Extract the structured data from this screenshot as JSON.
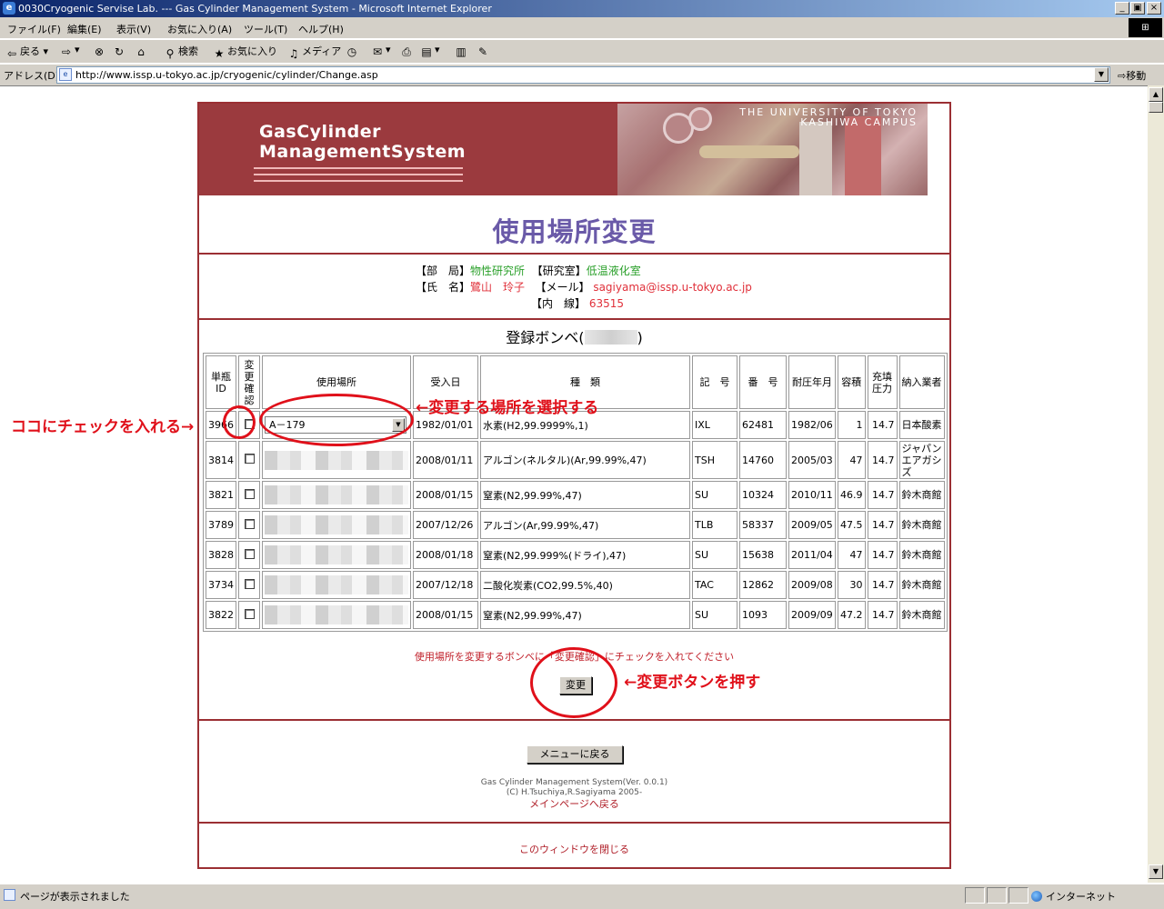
{
  "window": {
    "title": "0030Cryogenic Servise Lab. --- Gas Cylinder Management System - Microsoft Internet Explorer",
    "min": "_",
    "max": "▣",
    "close": "×"
  },
  "menu": [
    "ファイル(F)",
    "編集(E)",
    "表示(V)",
    "お気に入り(A)",
    "ツール(T)",
    "ヘルプ(H)"
  ],
  "toolbar": {
    "back": "戻る",
    "search": "検索",
    "favorites": "お気に入り",
    "media": "メディア"
  },
  "address": {
    "label": "アドレス(D)",
    "url": "http://www.issp.u-tokyo.ac.jp/cryogenic/cylinder/Change.asp",
    "go": "移動"
  },
  "banner": {
    "system_line1": "GasCylinder",
    "system_line2": "ManagementSystem",
    "univ_line1": "THE UNIVERSITY OF TOKYO",
    "univ_line2": "KASHIWA CAMPUS"
  },
  "page_title": "使用場所変更",
  "user": {
    "dept_label": "【部　局】",
    "dept": "物性研究所",
    "lab_label": "【研究室】",
    "lab": "低温液化室",
    "name_label": "【氏　名】",
    "name": "鷺山　玲子",
    "mail_label": "【メール】",
    "mail": "sagiyama@issp.u-tokyo.ac.jp",
    "ext_label": "【内　線】",
    "ext": "63515"
  },
  "registered_title": "登録ボンベ(",
  "registered_close": ")",
  "table": {
    "headers": [
      "単瓶ID",
      "変更確認",
      "使用場所",
      "受入日",
      "種　類",
      "記　号",
      "番　号",
      "耐圧年月",
      "容積",
      "充填圧力",
      "納入業者"
    ],
    "rows": [
      {
        "id": "3966",
        "location": "A－179",
        "date": "1982/01/01",
        "kind": "水素(H2,99.9999%,1)",
        "symbol": "IXL",
        "number": "62481",
        "ym": "1982/06",
        "vol": "1",
        "pressure": "14.7",
        "vendor": "日本酸素"
      },
      {
        "id": "3814",
        "location": "",
        "date": "2008/01/11",
        "kind": "アルゴン(ネルタル)(Ar,99.99%,47)",
        "symbol": "TSH",
        "number": "14760",
        "ym": "2005/03",
        "vol": "47",
        "pressure": "14.7",
        "vendor": "ジャパンエアガシズ"
      },
      {
        "id": "3821",
        "location": "",
        "date": "2008/01/15",
        "kind": "窒素(N2,99.99%,47)",
        "symbol": "SU",
        "number": "10324",
        "ym": "2010/11",
        "vol": "46.9",
        "pressure": "14.7",
        "vendor": "鈴木商館"
      },
      {
        "id": "3789",
        "location": "",
        "date": "2007/12/26",
        "kind": "アルゴン(Ar,99.99%,47)",
        "symbol": "TLB",
        "number": "58337",
        "ym": "2009/05",
        "vol": "47.5",
        "pressure": "14.7",
        "vendor": "鈴木商館"
      },
      {
        "id": "3828",
        "location": "",
        "date": "2008/01/18",
        "kind": "窒素(N2,99.999%(ドライ),47)",
        "symbol": "SU",
        "number": "15638",
        "ym": "2011/04",
        "vol": "47",
        "pressure": "14.7",
        "vendor": "鈴木商館"
      },
      {
        "id": "3734",
        "location": "",
        "date": "2007/12/18",
        "kind": "二酸化炭素(CO2,99.5%,40)",
        "symbol": "TAC",
        "number": "12862",
        "ym": "2009/08",
        "vol": "30",
        "pressure": "14.7",
        "vendor": "鈴木商館"
      },
      {
        "id": "3822",
        "location": "",
        "date": "2008/01/15",
        "kind": "窒素(N2,99.99%,47)",
        "symbol": "SU",
        "number": "1093",
        "ym": "2009/09",
        "vol": "47.2",
        "pressure": "14.7",
        "vendor": "鈴木商館"
      }
    ]
  },
  "note": "使用場所を変更するボンベに「変更確認」にチェックを入れてください",
  "buttons": {
    "change": "変更",
    "menu": "メニューに戻る"
  },
  "footer": {
    "version": "Gas Cylinder Management System(Ver. 0.0.1)",
    "copyright": "(C) H.Tsuchiya,R.Sagiyama 2005-",
    "main_link": "メインページへ戻る",
    "close_link": "このウィンドウを閉じる"
  },
  "annotations": {
    "check": "ココにチェックを入れる→",
    "select": "←変更する場所を選択する",
    "button": "←変更ボタンを押す"
  },
  "status": {
    "text": "ページが表示されました",
    "zone": "インターネット"
  }
}
